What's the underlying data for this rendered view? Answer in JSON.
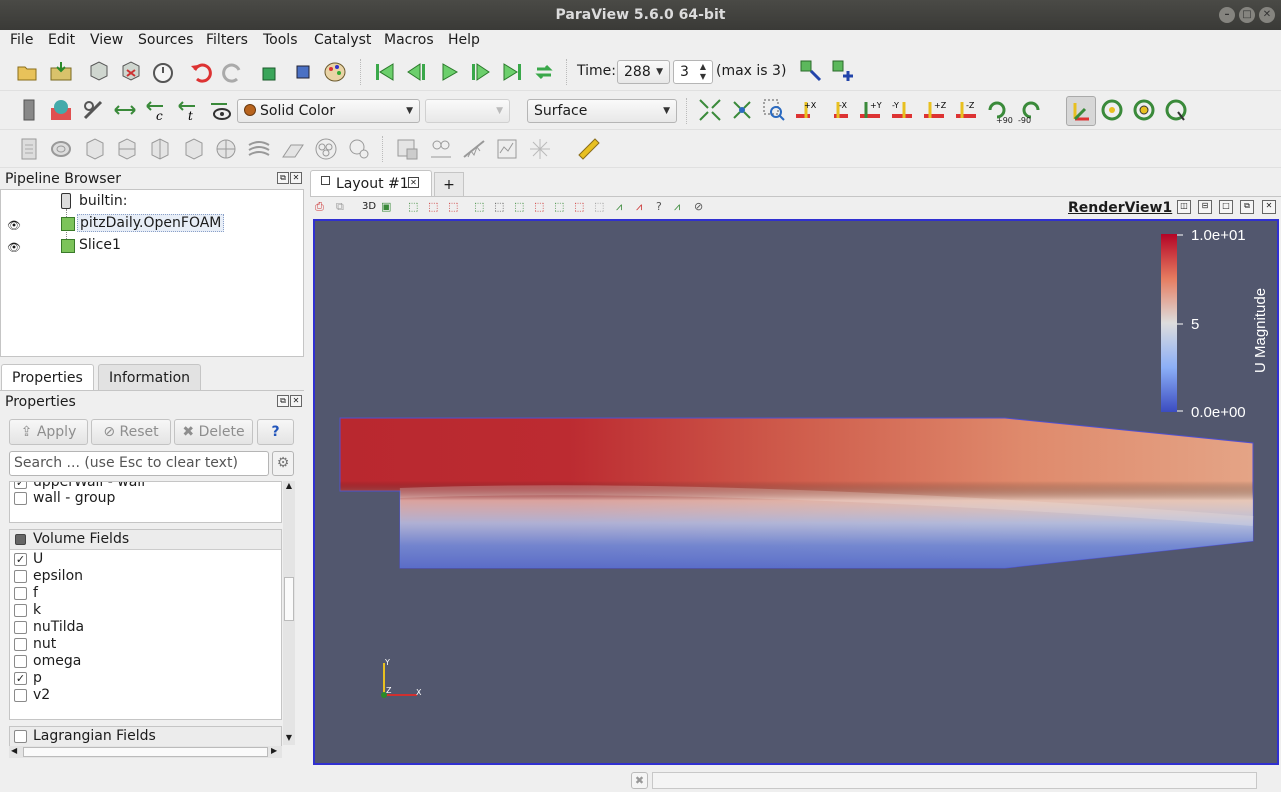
{
  "window": {
    "title": "ParaView 5.6.0 64-bit"
  },
  "menubar": {
    "items": [
      "File",
      "Edit",
      "View",
      "Sources",
      "Filters",
      "Tools",
      "Catalyst",
      "Macros",
      "Help"
    ]
  },
  "time_toolbar": {
    "time_label": "Time:",
    "time_value": "288",
    "step_value": "3",
    "max_text": "(max is 3)"
  },
  "display_toolbar": {
    "color_by": "Solid Color",
    "component": "",
    "representation": "Surface"
  },
  "camera_toolbar": {
    "plus90": "+90",
    "minus90": "-90"
  },
  "pipeline_browser": {
    "title": "Pipeline Browser",
    "items": [
      {
        "label": "builtin:"
      },
      {
        "label": "pitzDaily.OpenFOAM"
      },
      {
        "label": "Slice1"
      }
    ]
  },
  "tabs": {
    "properties": "Properties",
    "information": "Information"
  },
  "properties_panel": {
    "title": "Properties",
    "apply": "Apply",
    "reset": "Reset",
    "delete": "Delete",
    "help": "?",
    "search_placeholder": "Search ... (use Esc to clear text)",
    "patch_items": [
      {
        "label": "upperWall - wall",
        "checked": true
      },
      {
        "label": "wall - group",
        "checked": false
      }
    ],
    "volume_fields_header": "Volume Fields",
    "volume_fields": [
      {
        "label": "U",
        "checked": true
      },
      {
        "label": "epsilon",
        "checked": false
      },
      {
        "label": "f",
        "checked": false
      },
      {
        "label": "k",
        "checked": false
      },
      {
        "label": "nuTilda",
        "checked": false
      },
      {
        "label": "nut",
        "checked": false
      },
      {
        "label": "omega",
        "checked": false
      },
      {
        "label": "p",
        "checked": true
      },
      {
        "label": "v2",
        "checked": false
      }
    ],
    "lagrangian_header": "Lagrangian Fields"
  },
  "layout": {
    "tab_label": "Layout #1",
    "add_tab": "+",
    "view_name": "RenderView1",
    "mode_3d": "3D"
  },
  "render_view": {
    "colorbar": {
      "title": "U Magnitude",
      "max": "1.0e+01",
      "mid": "5",
      "min": "0.0e+00",
      "high_color": "#b40426",
      "mid_color": "#dddddd",
      "low_color": "#3b4cc0"
    },
    "axes": {
      "x": "X",
      "y": "Y",
      "z": "Z"
    },
    "background": "#52576e"
  }
}
